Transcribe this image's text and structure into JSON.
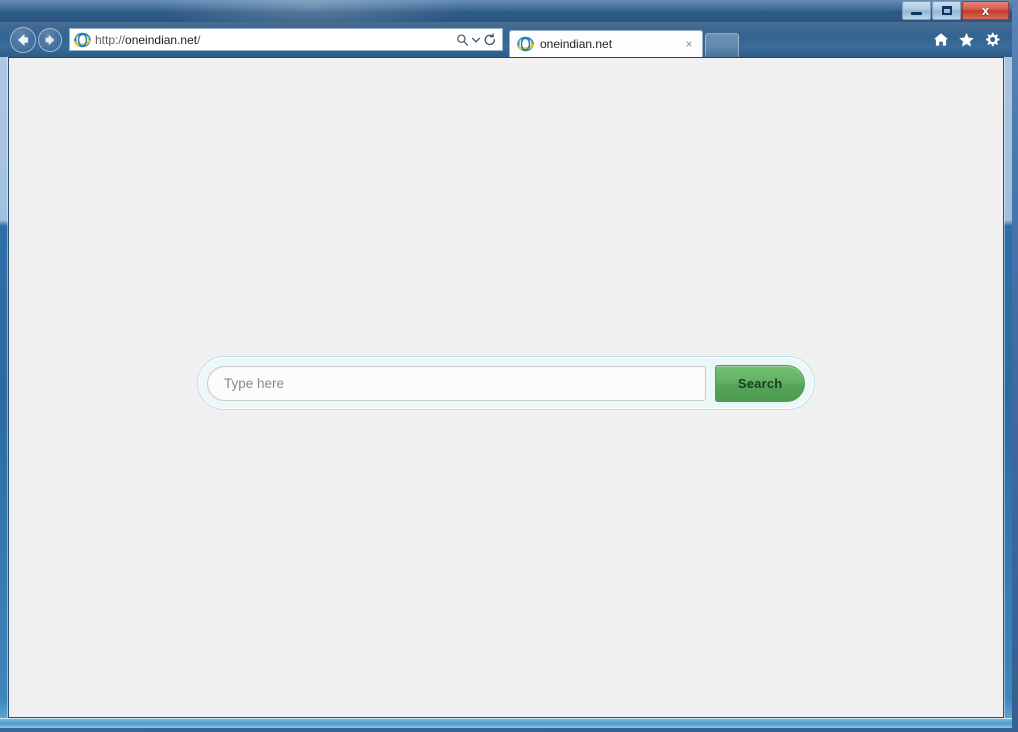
{
  "window": {
    "title": "oneindian.net",
    "controls": {
      "minimize_label": "Minimize",
      "maximize_label": "Maximize",
      "close_label": "x"
    }
  },
  "navigation": {
    "back_label": "Back",
    "forward_label": "Forward"
  },
  "address_bar": {
    "url_scheme": "http://",
    "url_host": "oneindian.net",
    "url_path": "/",
    "full_url": "http://oneindian.net/",
    "favicon": "internet-explorer-icon",
    "search_icon": "search-icon",
    "dropdown_icon": "chevron-down-icon",
    "refresh_icon": "refresh-icon"
  },
  "tabs": [
    {
      "title": "oneindian.net",
      "favicon": "internet-explorer-icon",
      "close_label": "×",
      "active": true
    }
  ],
  "new_tab": {
    "label": "New tab"
  },
  "toolbar_icons": [
    {
      "name": "home-icon",
      "label": "Home"
    },
    {
      "name": "favorites-star-icon",
      "label": "Favorites"
    },
    {
      "name": "settings-gear-icon",
      "label": "Tools"
    }
  ],
  "page": {
    "background_color": "#eff0ef",
    "search": {
      "input_value": "",
      "input_placeholder": "Type here",
      "button_label": "Search",
      "container_bg": "#ecf7fa",
      "container_border": "#c3e0e7",
      "button_color": "#5fae60",
      "button_border": "#4f9a55"
    }
  }
}
